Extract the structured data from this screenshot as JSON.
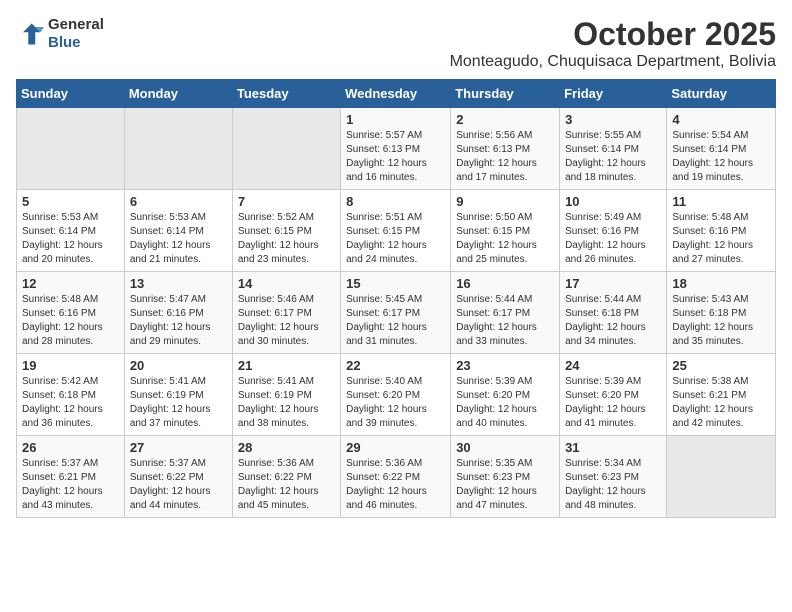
{
  "header": {
    "logo_general": "General",
    "logo_blue": "Blue",
    "month_title": "October 2025",
    "location": "Monteagudo, Chuquisaca Department, Bolivia"
  },
  "weekdays": [
    "Sunday",
    "Monday",
    "Tuesday",
    "Wednesday",
    "Thursday",
    "Friday",
    "Saturday"
  ],
  "weeks": [
    [
      {
        "day": "",
        "info": ""
      },
      {
        "day": "",
        "info": ""
      },
      {
        "day": "",
        "info": ""
      },
      {
        "day": "1",
        "info": "Sunrise: 5:57 AM\nSunset: 6:13 PM\nDaylight: 12 hours\nand 16 minutes."
      },
      {
        "day": "2",
        "info": "Sunrise: 5:56 AM\nSunset: 6:13 PM\nDaylight: 12 hours\nand 17 minutes."
      },
      {
        "day": "3",
        "info": "Sunrise: 5:55 AM\nSunset: 6:14 PM\nDaylight: 12 hours\nand 18 minutes."
      },
      {
        "day": "4",
        "info": "Sunrise: 5:54 AM\nSunset: 6:14 PM\nDaylight: 12 hours\nand 19 minutes."
      }
    ],
    [
      {
        "day": "5",
        "info": "Sunrise: 5:53 AM\nSunset: 6:14 PM\nDaylight: 12 hours\nand 20 minutes."
      },
      {
        "day": "6",
        "info": "Sunrise: 5:53 AM\nSunset: 6:14 PM\nDaylight: 12 hours\nand 21 minutes."
      },
      {
        "day": "7",
        "info": "Sunrise: 5:52 AM\nSunset: 6:15 PM\nDaylight: 12 hours\nand 23 minutes."
      },
      {
        "day": "8",
        "info": "Sunrise: 5:51 AM\nSunset: 6:15 PM\nDaylight: 12 hours\nand 24 minutes."
      },
      {
        "day": "9",
        "info": "Sunrise: 5:50 AM\nSunset: 6:15 PM\nDaylight: 12 hours\nand 25 minutes."
      },
      {
        "day": "10",
        "info": "Sunrise: 5:49 AM\nSunset: 6:16 PM\nDaylight: 12 hours\nand 26 minutes."
      },
      {
        "day": "11",
        "info": "Sunrise: 5:48 AM\nSunset: 6:16 PM\nDaylight: 12 hours\nand 27 minutes."
      }
    ],
    [
      {
        "day": "12",
        "info": "Sunrise: 5:48 AM\nSunset: 6:16 PM\nDaylight: 12 hours\nand 28 minutes."
      },
      {
        "day": "13",
        "info": "Sunrise: 5:47 AM\nSunset: 6:16 PM\nDaylight: 12 hours\nand 29 minutes."
      },
      {
        "day": "14",
        "info": "Sunrise: 5:46 AM\nSunset: 6:17 PM\nDaylight: 12 hours\nand 30 minutes."
      },
      {
        "day": "15",
        "info": "Sunrise: 5:45 AM\nSunset: 6:17 PM\nDaylight: 12 hours\nand 31 minutes."
      },
      {
        "day": "16",
        "info": "Sunrise: 5:44 AM\nSunset: 6:17 PM\nDaylight: 12 hours\nand 33 minutes."
      },
      {
        "day": "17",
        "info": "Sunrise: 5:44 AM\nSunset: 6:18 PM\nDaylight: 12 hours\nand 34 minutes."
      },
      {
        "day": "18",
        "info": "Sunrise: 5:43 AM\nSunset: 6:18 PM\nDaylight: 12 hours\nand 35 minutes."
      }
    ],
    [
      {
        "day": "19",
        "info": "Sunrise: 5:42 AM\nSunset: 6:18 PM\nDaylight: 12 hours\nand 36 minutes."
      },
      {
        "day": "20",
        "info": "Sunrise: 5:41 AM\nSunset: 6:19 PM\nDaylight: 12 hours\nand 37 minutes."
      },
      {
        "day": "21",
        "info": "Sunrise: 5:41 AM\nSunset: 6:19 PM\nDaylight: 12 hours\nand 38 minutes."
      },
      {
        "day": "22",
        "info": "Sunrise: 5:40 AM\nSunset: 6:20 PM\nDaylight: 12 hours\nand 39 minutes."
      },
      {
        "day": "23",
        "info": "Sunrise: 5:39 AM\nSunset: 6:20 PM\nDaylight: 12 hours\nand 40 minutes."
      },
      {
        "day": "24",
        "info": "Sunrise: 5:39 AM\nSunset: 6:20 PM\nDaylight: 12 hours\nand 41 minutes."
      },
      {
        "day": "25",
        "info": "Sunrise: 5:38 AM\nSunset: 6:21 PM\nDaylight: 12 hours\nand 42 minutes."
      }
    ],
    [
      {
        "day": "26",
        "info": "Sunrise: 5:37 AM\nSunset: 6:21 PM\nDaylight: 12 hours\nand 43 minutes."
      },
      {
        "day": "27",
        "info": "Sunrise: 5:37 AM\nSunset: 6:22 PM\nDaylight: 12 hours\nand 44 minutes."
      },
      {
        "day": "28",
        "info": "Sunrise: 5:36 AM\nSunset: 6:22 PM\nDaylight: 12 hours\nand 45 minutes."
      },
      {
        "day": "29",
        "info": "Sunrise: 5:36 AM\nSunset: 6:22 PM\nDaylight: 12 hours\nand 46 minutes."
      },
      {
        "day": "30",
        "info": "Sunrise: 5:35 AM\nSunset: 6:23 PM\nDaylight: 12 hours\nand 47 minutes."
      },
      {
        "day": "31",
        "info": "Sunrise: 5:34 AM\nSunset: 6:23 PM\nDaylight: 12 hours\nand 48 minutes."
      },
      {
        "day": "",
        "info": ""
      }
    ]
  ]
}
